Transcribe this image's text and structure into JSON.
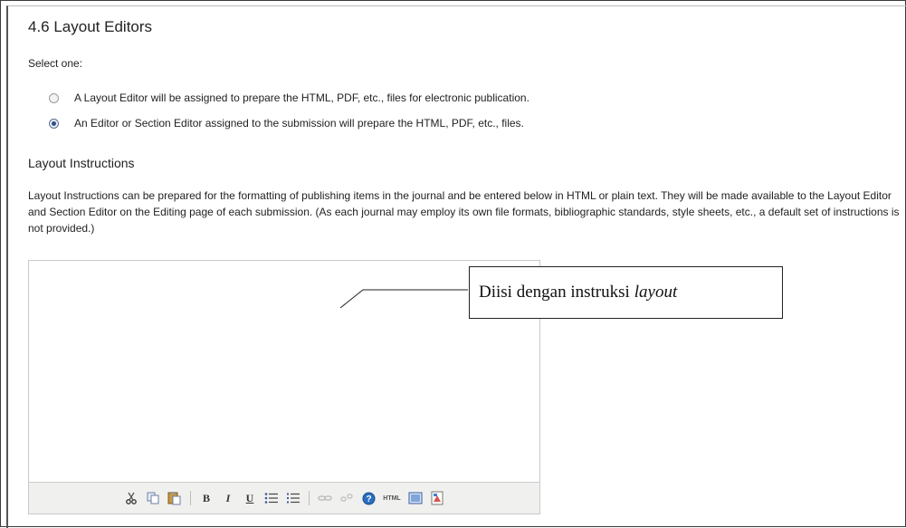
{
  "section": {
    "title": "4.6 Layout Editors",
    "select_label": "Select one:",
    "options": [
      {
        "label": "A Layout Editor will be assigned to prepare the HTML, PDF, etc., files for electronic publication.",
        "checked": false
      },
      {
        "label": "An Editor or Section Editor assigned to the submission will prepare the HTML, PDF, etc., files.",
        "checked": true
      }
    ],
    "instructions_heading": "Layout Instructions",
    "instructions_description": "Layout Instructions can be prepared for the formatting of publishing items in the journal and be entered below in HTML or plain text. They will be made available to the Layout Editor and Section Editor on the Editing page of each submission. (As each journal may employ its own file formats, bibliographic standards, style sheets, etc., a default set of instructions is not provided.)"
  },
  "editor": {
    "value": "",
    "toolbar": [
      {
        "name": "cut-icon"
      },
      {
        "name": "copy-icon"
      },
      {
        "name": "paste-icon"
      },
      {
        "name": "bold-icon",
        "glyph": "B"
      },
      {
        "name": "italic-icon",
        "glyph": "I"
      },
      {
        "name": "underline-icon",
        "glyph": "U"
      },
      {
        "name": "bullet-list-icon"
      },
      {
        "name": "numbered-list-icon"
      },
      {
        "name": "link-icon"
      },
      {
        "name": "unlink-icon"
      },
      {
        "name": "help-icon"
      },
      {
        "name": "html-icon",
        "glyph": "HTML"
      },
      {
        "name": "fullscreen-icon"
      },
      {
        "name": "image-icon"
      }
    ]
  },
  "annotation": {
    "text": "Diisi dengan instruksi",
    "emphasis": "layout"
  },
  "colors": {
    "radio_selected": "#2e4e86",
    "toolbar_bg": "#f0f0ee",
    "help_icon": "#2a6fc0"
  }
}
